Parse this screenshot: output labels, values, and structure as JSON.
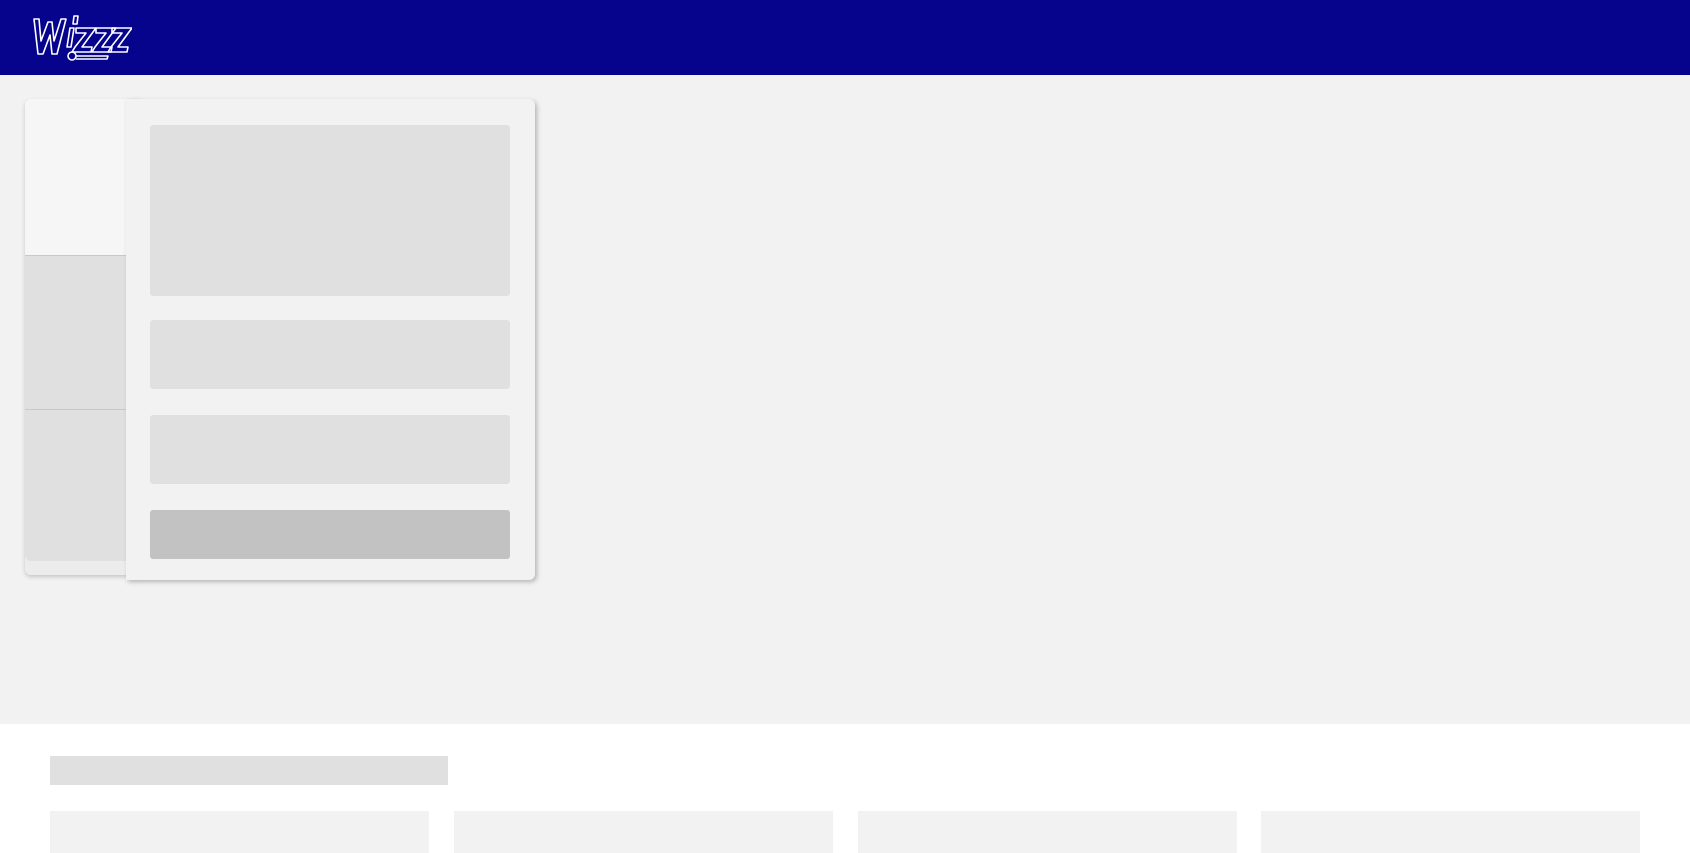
{
  "header": {
    "brand_color": "#06038d",
    "logo_text": "Wizz",
    "logo_icon": "wizz-logo"
  },
  "booking_widget": {
    "loading_state": "skeleton",
    "tabs_count": 3,
    "skeleton_fields": 4
  },
  "footer": {
    "loading_state": "skeleton",
    "tiles_count": 4
  },
  "colors": {
    "page_bg": "#f2f2f2",
    "skeleton": "#e0e0e0",
    "skeleton_button": "#c2c2c2"
  }
}
